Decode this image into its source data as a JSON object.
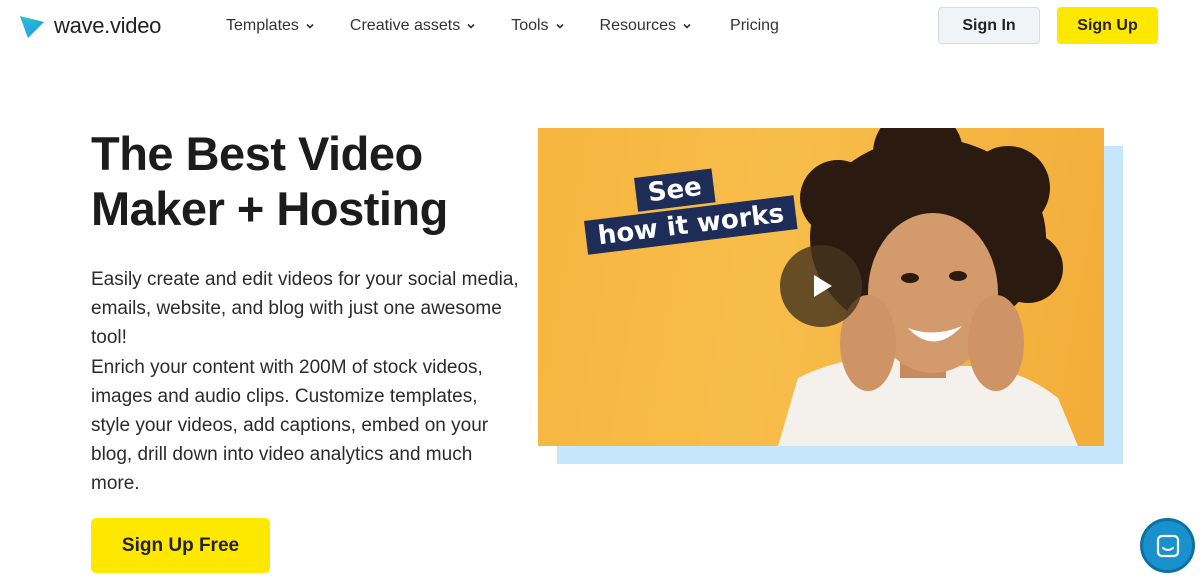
{
  "header": {
    "logo_text": "wave.video",
    "nav": [
      {
        "label": "Templates",
        "has_dropdown": true
      },
      {
        "label": "Creative assets",
        "has_dropdown": true
      },
      {
        "label": "Tools",
        "has_dropdown": true
      },
      {
        "label": "Resources",
        "has_dropdown": true
      },
      {
        "label": "Pricing",
        "has_dropdown": false
      }
    ],
    "sign_in_label": "Sign In",
    "sign_up_label": "Sign Up"
  },
  "hero": {
    "title_line1": "The Best Video",
    "title_line2": "Maker + Hosting",
    "description_p1": "Easily create and edit videos for your social media, emails, website, and blog with just one awesome tool!",
    "description_p2": "Enrich your content with 200M of stock videos, images and audio clips. Customize templates, style your videos, add captions, embed on your blog, drill down into video analytics and much more.",
    "cta_label": "Sign Up Free"
  },
  "video": {
    "overlay_line1": "See",
    "overlay_line2": "how it works",
    "play_icon": "play-icon"
  },
  "chat": {
    "icon": "chat-icon"
  },
  "colors": {
    "accent_yellow": "#ffe800",
    "video_bg": "#f6b63f",
    "shadow_blue": "#c5e6fb",
    "label_navy": "#1d2d57",
    "chat_blue": "#1891cd"
  }
}
